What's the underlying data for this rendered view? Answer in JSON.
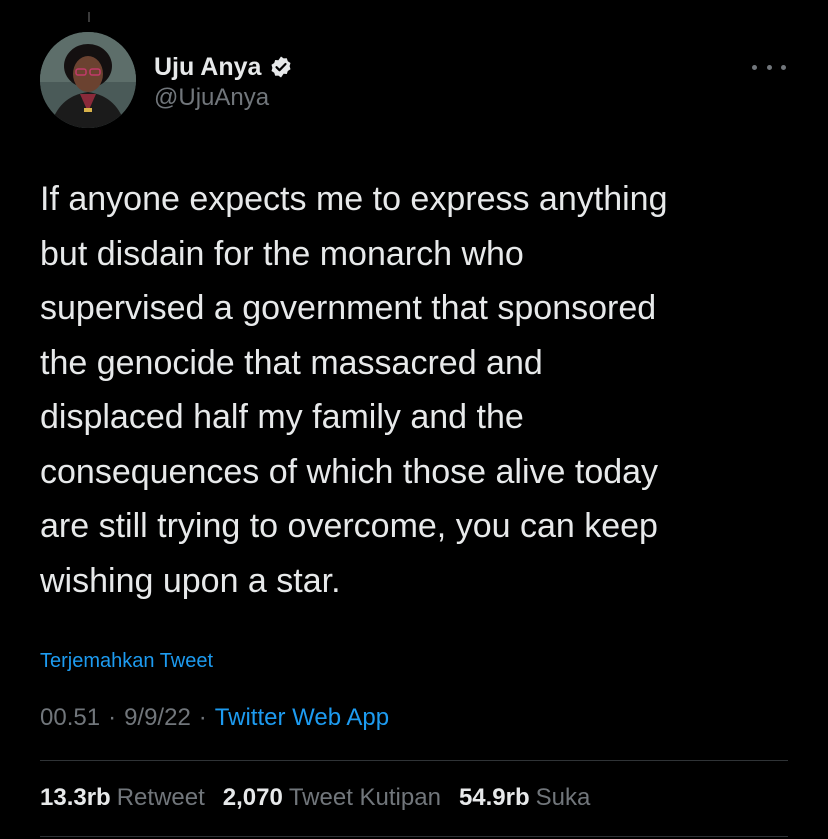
{
  "author": {
    "display_name": "Uju Anya",
    "handle": "@UjuAnya",
    "verified": true
  },
  "icons": {
    "verified": "verified-badge-icon",
    "more": "more-horizontal-icon"
  },
  "tweet": {
    "text": "If anyone expects me to express anything\nbut disdain for the monarch who\nsupervised a government that sponsored\nthe genocide that massacred and\ndisplaced half my family and the\nconsequences of which those alive today\nare still trying to overcome, you can keep\nwishing upon a star.",
    "translate_label": "Terjemahkan Tweet",
    "time": "00.51",
    "separator1": "·",
    "date": "9/9/22",
    "separator2": "·",
    "source": "Twitter Web App"
  },
  "stats": [
    {
      "count": "13.3rb",
      "label": "Retweet"
    },
    {
      "count": "2,070",
      "label": "Tweet Kutipan"
    },
    {
      "count": "54.9rb",
      "label": "Suka"
    }
  ],
  "colors": {
    "background": "#000000",
    "text_primary": "#e7e9ea",
    "text_secondary": "#71767b",
    "accent": "#1d9bf0",
    "divider": "#2f3336"
  }
}
